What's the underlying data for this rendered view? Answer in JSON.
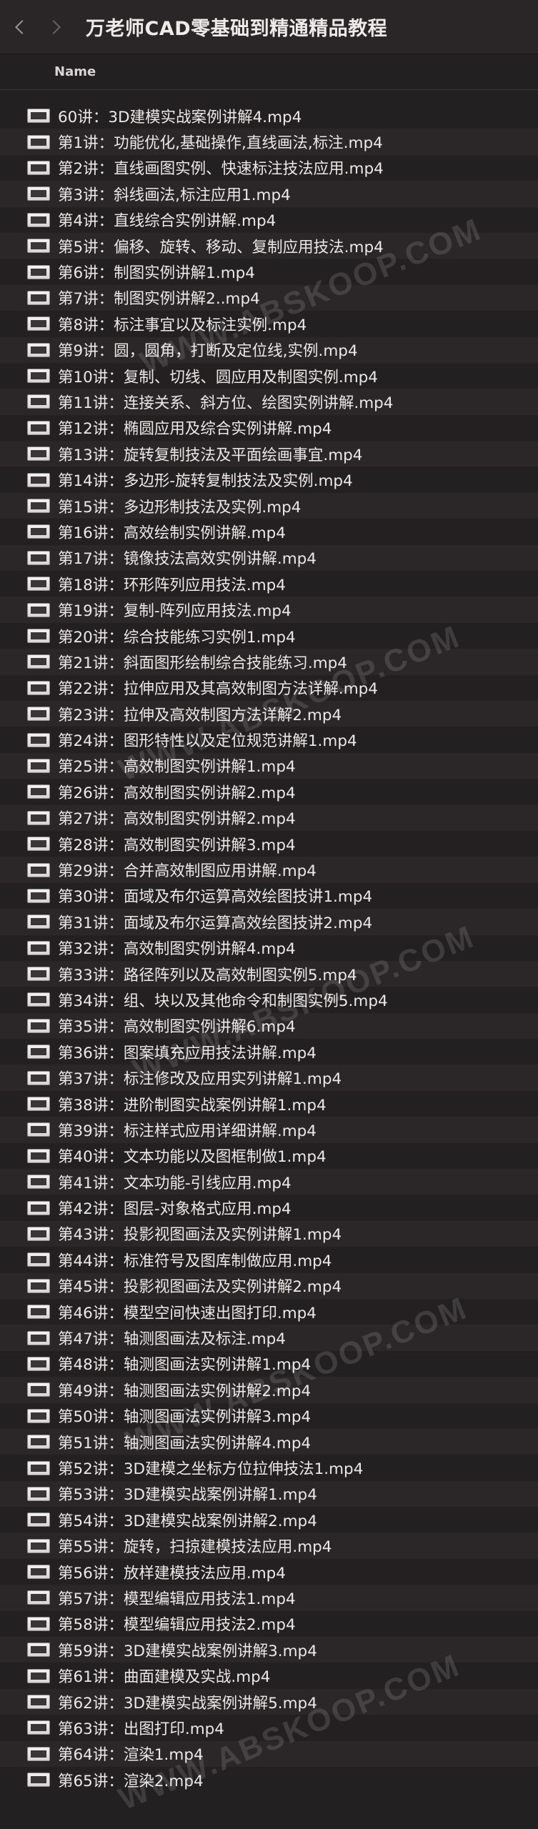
{
  "window": {
    "title": "万老师CAD零基础到精通精品教程"
  },
  "list": {
    "column_name": "Name",
    "files": [
      "60讲：3D建模实战案例讲解4.mp4",
      "第1讲：功能优化,基础操作,直线画法,标注.mp4",
      "第2讲：直线画图实例、快速标注技法应用.mp4",
      "第3讲：斜线画法,标注应用1.mp4",
      "第4讲：直线综合实例讲解.mp4",
      "第5讲：偏移、旋转、移动、复制应用技法.mp4",
      "第6讲：制图实例讲解1.mp4",
      "第7讲：制图实例讲解2..mp4",
      "第8讲：标注事宜以及标注实例.mp4",
      "第9讲：圆，圆角，打断及定位线,实例.mp4",
      "第10讲：复制、切线、圆应用及制图实例.mp4",
      "第11讲：连接关系、斜方位、绘图实例讲解.mp4",
      "第12讲：椭圆应用及综合实例讲解.mp4",
      "第13讲：旋转复制技法及平面绘画事宜.mp4",
      "第14讲：多边形-旋转复制技法及实例.mp4",
      "第15讲：多边形制技法及实例.mp4",
      "第16讲：高效绘制实例讲解.mp4",
      "第17讲：镜像技法高效实例讲解.mp4",
      "第18讲：环形阵列应用技法.mp4",
      "第19讲：复制-阵列应用技法.mp4",
      "第20讲：综合技能练习实例1.mp4",
      "第21讲：斜面图形绘制综合技能练习.mp4",
      "第22讲：拉伸应用及其高效制图方法详解.mp4",
      "第23讲：拉伸及高效制图方法详解2.mp4",
      "第24讲：图形特性以及定位规范讲解1.mp4",
      "第25讲：高效制图实例讲解1.mp4",
      "第26讲：高效制图实例讲解2.mp4",
      "第27讲：高效制图实例讲解2.mp4",
      "第28讲：高效制图实例讲解3.mp4",
      "第29讲：合并高效制图应用讲解.mp4",
      "第30讲：面域及布尔运算高效绘图技讲1.mp4",
      "第31讲：面域及布尔运算高效绘图技讲2.mp4",
      "第32讲：高效制图实例讲解4.mp4",
      "第33讲：路径阵列以及高效制图实例5.mp4",
      "第34讲：组、块以及其他命令和制图实例5.mp4",
      "第35讲：高效制图实例讲解6.mp4",
      "第36讲：图案填充应用技法讲解.mp4",
      "第37讲：标注修改及应用实列讲解1.mp4",
      "第38讲：进阶制图实战案例讲解1.mp4",
      "第39讲：标注样式应用详细讲解.mp4",
      "第40讲：文本功能以及图框制做1.mp4",
      "第41讲：文本功能-引线应用.mp4",
      "第42讲：图层-对象格式应用.mp4",
      "第43讲：投影视图画法及实例讲解1.mp4",
      "第44讲：标准符号及图库制做应用.mp4",
      "第45讲：投影视图画法及实例讲解2.mp4",
      "第46讲：模型空间快速出图打印.mp4",
      "第47讲：轴测图画法及标注.mp4",
      "第48讲：轴测图画法实例讲解1.mp4",
      "第49讲：轴测图画法实例讲解2.mp4",
      "第50讲：轴测图画法实例讲解3.mp4",
      "第51讲：轴测图画法实例讲解4.mp4",
      "第52讲：3D建模之坐标方位拉伸技法1.mp4",
      "第53讲：3D建模实战案例讲解1.mp4",
      "第54讲：3D建模实战案例讲解2.mp4",
      "第55讲：旋转，扫掠建模技法应用.mp4",
      "第56讲：放样建模技法应用.mp4",
      "第57讲：模型编辑应用技法1.mp4",
      "第58讲：模型编辑应用技法2.mp4",
      "第59讲：3D建模实战案例讲解3.mp4",
      "第61讲：曲面建模及实战.mp4",
      "第62讲：3D建模实战案例讲解5.mp4",
      "第63讲：出图打印.mp4",
      "第64讲：渲染1.mp4",
      "第65讲：渲染2.mp4"
    ]
  },
  "watermark": {
    "text": "WWW.ABSKOOP.COM"
  }
}
